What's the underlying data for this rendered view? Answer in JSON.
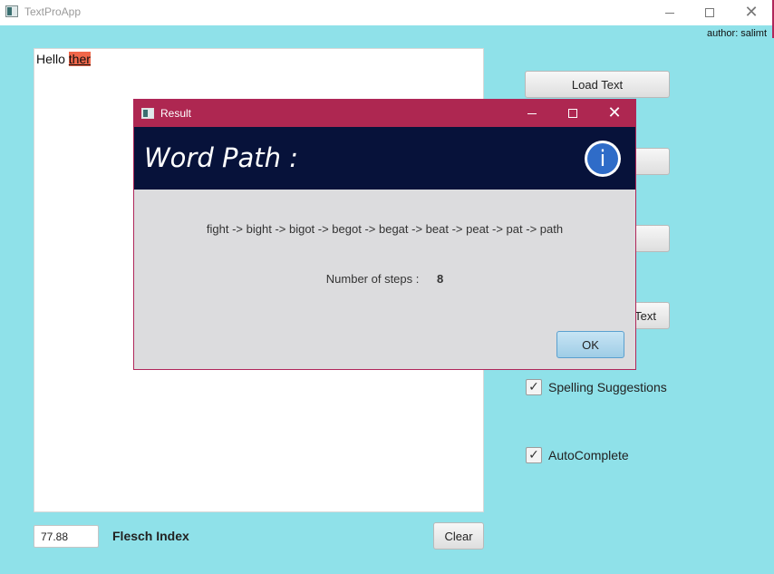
{
  "window": {
    "title": "TextProApp",
    "author": "author: salimt"
  },
  "editor": {
    "word_plain": "Hello ",
    "word_misspelled": "ther"
  },
  "sidebar": {
    "load_button": "Load Text",
    "button2": "",
    "button3": "",
    "button4_partial": "Text",
    "spelling_label": "Spelling Suggestions",
    "spelling_checked": true,
    "autocomplete_label": "AutoComplete",
    "autocomplete_checked": true,
    "check_glyph": "✓"
  },
  "footer": {
    "flesch_value": "77.88",
    "flesch_label": "Flesch Index",
    "clear_button": "Clear"
  },
  "dialog": {
    "title": "Result",
    "heading": "Word Path :",
    "info_glyph": "i",
    "path": "fight -> bight -> bigot -> begot -> begat -> beat -> peat -> pat -> path",
    "steps_label": "Number of steps :",
    "steps_value": "8",
    "ok_button": "OK"
  },
  "icons": {
    "minimize": "minimize-icon",
    "maximize": "maximize-icon",
    "close": "close-icon",
    "close_glyph": "✕"
  },
  "colors": {
    "background": "#8fe1e9",
    "dialog_titlebar": "#ae2751",
    "dialog_header": "#07123a",
    "misspelled_highlight": "#f0674a"
  }
}
